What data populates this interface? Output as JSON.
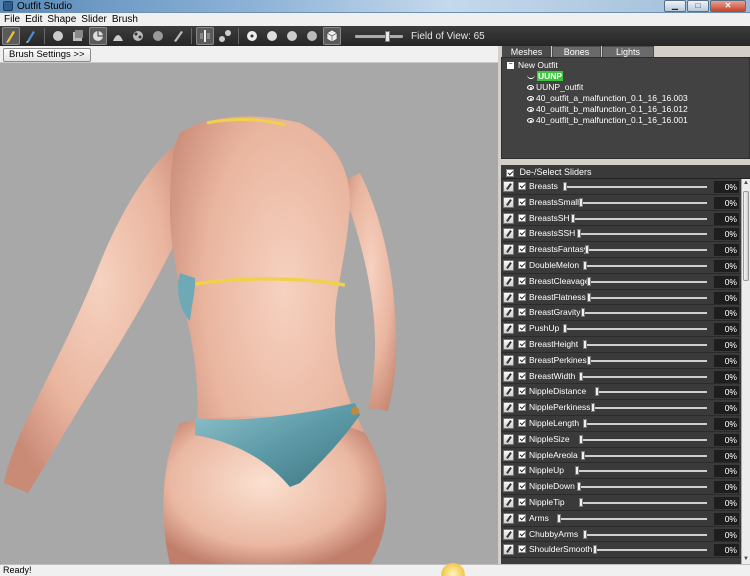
{
  "window": {
    "title": "Outfit Studio"
  },
  "menu": [
    "File",
    "Edit",
    "Shape",
    "Slider",
    "Brush"
  ],
  "toolbar": {
    "fov_label": "Field of View: 65",
    "fov_value": 65
  },
  "viewport": {
    "brush_settings_label": "Brush Settings >>"
  },
  "tabs": [
    "Meshes",
    "Bones",
    "Lights"
  ],
  "meshes": {
    "root": "New Outfit",
    "selected": "UUNP",
    "items": [
      "UUNP_outfit",
      "40_outfit_a_malfunction_0.1_16_16.003",
      "40_outfit_b_malfunction_0.1_16_16.012",
      "40_outfit_b_malfunction_0.1_16_16.001"
    ]
  },
  "sliders_header": "De-/Select Sliders",
  "sliders": [
    {
      "name": "Breasts",
      "value": "0%",
      "pos": 0
    },
    {
      "name": "BreastsSmall",
      "value": "0%",
      "pos": 0
    },
    {
      "name": "BreastsSH",
      "value": "0%",
      "pos": 0
    },
    {
      "name": "BreastsSSH",
      "value": "0%",
      "pos": 0
    },
    {
      "name": "BreastsFantasy",
      "value": "0%",
      "pos": 0
    },
    {
      "name": "DoubleMelon",
      "value": "0%",
      "pos": 0
    },
    {
      "name": "BreastCleavage",
      "value": "0%",
      "pos": 0
    },
    {
      "name": "BreastFlatness",
      "value": "0%",
      "pos": 0
    },
    {
      "name": "BreastGravity",
      "value": "0%",
      "pos": 0
    },
    {
      "name": "PushUp",
      "value": "0%",
      "pos": 0
    },
    {
      "name": "BreastHeight",
      "value": "0%",
      "pos": 0
    },
    {
      "name": "BreastPerkiness",
      "value": "0%",
      "pos": 0
    },
    {
      "name": "BreastWidth",
      "value": "0%",
      "pos": 0
    },
    {
      "name": "NippleDistance",
      "value": "0%",
      "pos": 0
    },
    {
      "name": "NipplePerkiness",
      "value": "0%",
      "pos": 0
    },
    {
      "name": "NippleLength",
      "value": "0%",
      "pos": 0
    },
    {
      "name": "NippleSize",
      "value": "0%",
      "pos": 0
    },
    {
      "name": "NippleAreola",
      "value": "0%",
      "pos": 0
    },
    {
      "name": "NippleUp",
      "value": "0%",
      "pos": 0
    },
    {
      "name": "NippleDown",
      "value": "0%",
      "pos": 0
    },
    {
      "name": "NippleTip",
      "value": "0%",
      "pos": 0
    },
    {
      "name": "Arms",
      "value": "0%",
      "pos": 0
    },
    {
      "name": "ChubbyArms",
      "value": "0%",
      "pos": 0
    },
    {
      "name": "ShoulderSmooth",
      "value": "0%",
      "pos": 0
    }
  ],
  "status": {
    "text": "Ready!"
  },
  "colors": {
    "skin": "#e8b9a3",
    "bikini_top": "#f1d04a",
    "bottom": "#6fa9b6",
    "viewport_bg": "#a8a8a8",
    "selected_mesh": "#3cc83c"
  }
}
